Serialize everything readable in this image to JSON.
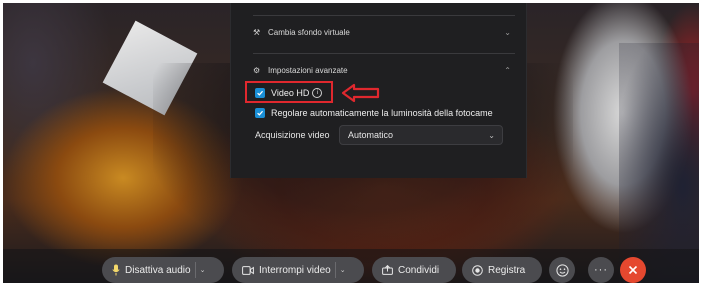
{
  "settings_panel": {
    "background_section": {
      "label": "Cambia sfondo virtuale",
      "icon": "magic-wand-icon"
    },
    "advanced_section": {
      "label": "Impostazioni avanzate",
      "icon": "gear-icon"
    },
    "hd_video": {
      "label": "Video HD",
      "checked": true,
      "info_icon": "info-icon"
    },
    "auto_brightness": {
      "label": "Regolare automaticamente la luminosità della fotocame",
      "checked": true
    },
    "video_capture": {
      "label": "Acquisizione video",
      "value": "Automatico"
    }
  },
  "annotation": {
    "box_color": "#e0282e",
    "arrow_color": "#e0282e"
  },
  "toolbar": {
    "mute_label": "Disattiva audio",
    "stop_video_label": "Interrompi video",
    "share_label": "Condividi",
    "record_label": "Registra",
    "reactions_icon": "emoji-icon",
    "more_icon": "more-icon",
    "leave_icon": "close-icon",
    "leave_color": "#e5482f",
    "accent": "#1a8fd6"
  }
}
